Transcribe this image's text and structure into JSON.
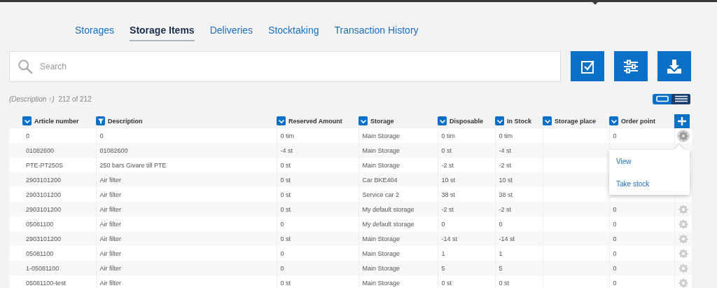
{
  "tabs": [
    {
      "label": "Storages",
      "selected": false
    },
    {
      "label": "Storage Items",
      "selected": true
    },
    {
      "label": "Deliveries",
      "selected": false
    },
    {
      "label": "Stocktaking",
      "selected": false
    },
    {
      "label": "Transaction History",
      "selected": false
    }
  ],
  "search": {
    "placeholder": "Search"
  },
  "toolbar_buttons": [
    {
      "kind": "check"
    },
    {
      "kind": "sliders"
    },
    {
      "kind": "download"
    }
  ],
  "sort_info": "(Description ↑)",
  "count": "212 of 212",
  "view_toggle": [
    {
      "kind": "card",
      "selected": false
    },
    {
      "kind": "list",
      "selected": true
    }
  ],
  "table": {
    "columns": [
      {
        "label": "Article number",
        "kind": "sort"
      },
      {
        "label": "Description",
        "kind": "filter"
      },
      {
        "label": "Reserved Amount",
        "kind": "sort"
      },
      {
        "label": "Storage",
        "kind": "sort"
      },
      {
        "label": "Disposable",
        "kind": "sort"
      },
      {
        "label": "In Stock",
        "kind": "sort"
      },
      {
        "label": "Storage place",
        "kind": "sort"
      },
      {
        "label": "Order point",
        "kind": "sort"
      }
    ],
    "rows": [
      {
        "cells": [
          "0",
          "0",
          "0 tim",
          "Main Storage",
          "0 tim",
          "0 tim",
          "",
          "0"
        ],
        "gear": {
          "highlighted": true
        }
      },
      {
        "cells": [
          "01082600",
          "01082600",
          "-4 st",
          "Main Storage",
          "0 st",
          "-4 st",
          "",
          ""
        ]
      },
      {
        "cells": [
          "PTE-PT250S",
          "250 bars Givare till PTE",
          "0 st",
          "Main Storage",
          "-2 st",
          "-2 st",
          "",
          ""
        ]
      },
      {
        "cells": [
          "2903101200",
          "Air filter",
          "0 st",
          "Car BKE404",
          "10 st",
          "10 st",
          "",
          ""
        ]
      },
      {
        "cells": [
          "2903101200",
          "Air filter",
          "0 st",
          "Service car 2",
          "38 st",
          "38 st",
          "",
          ""
        ]
      },
      {
        "cells": [
          "2903101200",
          "Air filter",
          "0 st",
          "My default storage",
          "-2 st",
          "-2 st",
          "",
          "0"
        ],
        "gear": {
          "highlighted": false
        }
      },
      {
        "cells": [
          "05081100",
          "Air filter",
          "0",
          "My default storage",
          "0",
          "0",
          "",
          "0"
        ],
        "gear": {
          "highlighted": false
        }
      },
      {
        "cells": [
          "2903101200",
          "Air filter",
          "0 st",
          "Main Storage",
          "-14 st",
          "-14 st",
          "",
          "0"
        ],
        "gear": {
          "highlighted": false
        }
      },
      {
        "cells": [
          "05081100",
          "Air filter",
          "0",
          "Main Storage",
          "1",
          "1",
          "",
          "0"
        ],
        "gear": {
          "highlighted": false
        }
      },
      {
        "cells": [
          "1-05081100",
          "Air filter",
          "0",
          "Main Storage",
          "5",
          "5",
          "",
          "0"
        ],
        "gear": {
          "highlighted": false
        }
      },
      {
        "cells": [
          "05081100-test",
          "Air filter",
          "0 st",
          "Main Storage",
          "0 st",
          "0 st",
          "",
          "0"
        ],
        "gear": {
          "highlighted": false
        }
      }
    ]
  },
  "row_menu": {
    "items": [
      "View",
      "Take stock"
    ]
  }
}
